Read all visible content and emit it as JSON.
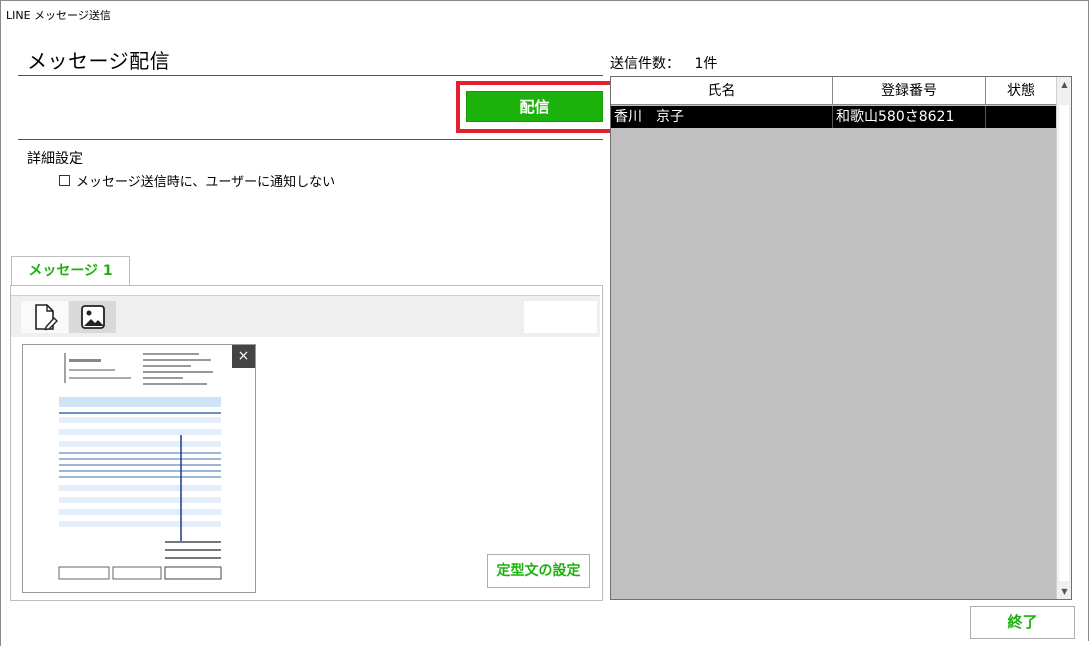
{
  "window": {
    "title": "LINE メッセージ送信"
  },
  "header": {
    "title": "メッセージ配信"
  },
  "actions": {
    "send_label": "配信",
    "end_label": "終了"
  },
  "details": {
    "section_title": "詳細設定",
    "no_notify_label": "メッセージ送信時に、ユーザーに通知しない",
    "no_notify_checked": false
  },
  "tabs": [
    {
      "label": "メッセージ 1",
      "active": true
    }
  ],
  "editor": {
    "tools": [
      {
        "icon": "text-edit-icon",
        "active": false
      },
      {
        "icon": "image-icon",
        "active": true
      }
    ],
    "remove_attachment": "×",
    "template_button_label": "定型文の設定"
  },
  "recipients": {
    "count_label": "送信件数：",
    "count_value": "1件",
    "columns": [
      "氏名",
      "登録番号",
      "状態"
    ],
    "rows": [
      {
        "name": "香川　京子",
        "reg_no": "和歌山580さ8621",
        "status": ""
      }
    ]
  },
  "colors": {
    "accent": "#1bb20c",
    "highlight": "#e3202c",
    "selection": "#000000",
    "grid_bg": "#c0c0c0"
  }
}
